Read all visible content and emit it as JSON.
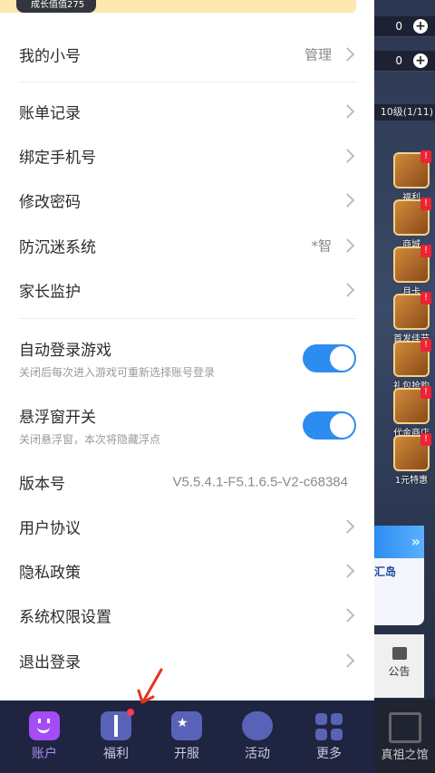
{
  "top_banner": {
    "text": "成长值值275"
  },
  "game_hud": {
    "counters": [
      "0",
      "0"
    ],
    "level_text": "10级(1/11)",
    "side_icons": [
      {
        "label": "福利",
        "badge": "!"
      },
      {
        "label": "商城",
        "badge": "!"
      },
      {
        "label": "月卡",
        "badge": "!"
      },
      {
        "label": "首发佳节",
        "badge": "!"
      },
      {
        "label": "礼包抢购",
        "badge": "!"
      },
      {
        "label": "代金商店",
        "badge": "!"
      },
      {
        "label": "1元特惠",
        "badge": "!"
      }
    ],
    "event_card_title": "汇岛",
    "notice_label": "公告",
    "bottom_right_label": "真祖之馆"
  },
  "menu": {
    "my_accounts": {
      "label": "我的小号",
      "right": "管理"
    },
    "bill_records": {
      "label": "账单记录"
    },
    "bind_phone": {
      "label": "绑定手机号"
    },
    "change_password": {
      "label": "修改密码"
    },
    "anti_addiction": {
      "label": "防沉迷系统",
      "right": "*智"
    },
    "parental_monitor": {
      "label": "家长监护"
    },
    "auto_login": {
      "label": "自动登录游戏",
      "desc": "关闭后每次进入游戏可重新选择账号登录",
      "enabled": true
    },
    "floating_window": {
      "label": "悬浮窗开关",
      "desc": "关闭悬浮窗，本次将隐藏浮点",
      "enabled": true
    },
    "version": {
      "label": "版本号",
      "value": "V5.5.4.1-F5.1.6.5-V2-c68384"
    },
    "user_agreement": {
      "label": "用户协议"
    },
    "privacy_policy": {
      "label": "隐私政策"
    },
    "permission_settings": {
      "label": "系统权限设置"
    },
    "logout": {
      "label": "退出登录"
    }
  },
  "bottom_nav": [
    {
      "label": "账户",
      "icon": "smile-icon",
      "active": true
    },
    {
      "label": "福利",
      "icon": "gift-icon",
      "active": false,
      "dot": true
    },
    {
      "label": "开服",
      "icon": "gamepad-icon",
      "active": false
    },
    {
      "label": "活动",
      "icon": "controller-icon",
      "active": false
    },
    {
      "label": "更多",
      "icon": "grid-icon",
      "active": false
    }
  ],
  "colors": {
    "accent": "#2d8cf0",
    "nav_bg": "#1f2540",
    "nav_active": "#a88bf7",
    "annotation_arrow": "#e8321e"
  }
}
